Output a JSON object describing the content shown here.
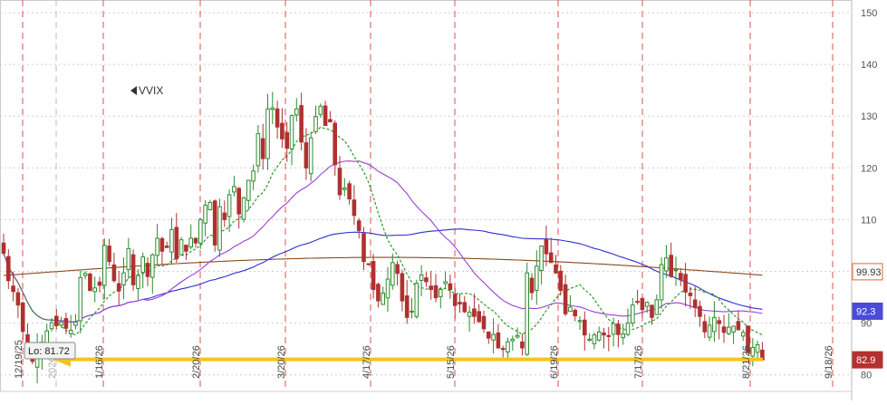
{
  "chart_data": {
    "type": "candlestick",
    "symbol": "VVIX",
    "y_ticks": [
      80,
      90,
      100,
      110,
      120,
      130,
      140,
      150
    ],
    "ylim": [
      76,
      152
    ],
    "date_ticks": [
      "12/19/25",
      "1/16/26",
      "2/20/26",
      "3/20/26",
      "4/17/26",
      "5/15/26",
      "6/19/26",
      "7/17/26",
      "8/21/26",
      "9/18/26"
    ],
    "year_marker": "2026",
    "badges": [
      {
        "label": "99.93",
        "value": 99.93,
        "bg": "#ffffff",
        "fg": "#333333",
        "border": "#e06a1c"
      },
      {
        "label": "92.3",
        "value": 92.3,
        "bg": "#4b4bd9",
        "fg": "#ffffff",
        "border": "#4b4bd9"
      },
      {
        "label": "82.9",
        "value": 82.9,
        "bg": "#b5302f",
        "fg": "#ffffff",
        "border": "#b5302f"
      }
    ],
    "low_label": "Lo: 81.72",
    "low_value": 81.72,
    "support_line": {
      "value": 83.0,
      "color": "#f5c31c"
    },
    "colors": {
      "up": "#2e8b2e",
      "down": "#b03030",
      "sma20": "#2f9a2f",
      "sma50": "#9b3fd9",
      "sma100": "#2f2fcf",
      "sma200": "#8a4b20",
      "vline": "#d9534f"
    },
    "close": [
      103.5,
      98.2,
      96.1,
      93.5,
      88.4,
      84.3,
      82.6,
      85.0,
      86.3,
      88.5,
      90.1,
      89.5,
      90.2,
      89.0,
      88.6,
      90.2,
      98.8,
      99.6,
      96.3,
      96.8,
      97.3,
      105.0,
      101.9,
      98.2,
      96.2,
      99.7,
      104.4,
      97.4,
      99.2,
      102.8,
      99.0,
      103.2,
      106.4,
      103.9,
      104.6,
      108.1,
      102.4,
      106.1,
      103.9,
      106.4,
      105.5,
      110.0,
      112.8,
      113.3,
      105.1,
      112.5,
      110.0,
      114.8,
      116.4,
      111.1,
      114.2,
      117.6,
      119.4,
      126.6,
      121.8,
      131.4,
      131.6,
      127.9,
      125.6,
      123.8,
      130.1,
      131.4,
      125.0,
      120.0,
      125.8,
      129.9,
      131.9,
      128.2,
      128.9,
      120.6,
      114.8,
      116.1,
      114.0,
      110.8,
      107.9,
      101.9,
      101.3,
      96.5,
      94.3,
      95.8,
      98.5,
      101.7,
      99.6,
      94.3,
      91.1,
      92.3,
      97.7,
      99.3,
      98.0,
      96.5,
      94.9,
      96.5,
      98.0,
      96.5,
      93.4,
      93.7,
      92.2,
      92.1,
      91.3,
      90.3,
      88.9,
      87.1,
      87.8,
      85.2,
      84.9,
      86.4,
      86.9,
      87.6,
      85.2,
      99.7,
      95.9,
      101.0,
      104.9,
      103.4,
      101.7,
      99.7,
      96.3,
      91.8,
      93.1,
      91.4,
      90.5,
      87.7,
      86.9,
      87.7,
      88.3,
      87.7,
      87.4,
      89.9,
      87.8,
      87.9,
      90.0,
      93.5,
      94.2,
      92.6,
      94.0,
      91.1,
      94.5,
      101.3,
      102.6,
      99.0,
      100.3,
      98.4,
      96.0,
      95.3,
      93.0,
      91.3,
      88.3,
      89.6,
      91.1,
      89.9,
      88.2,
      89.2,
      89.4,
      88.7,
      88.2,
      84.3,
      85.3,
      85.8,
      82.9
    ]
  }
}
